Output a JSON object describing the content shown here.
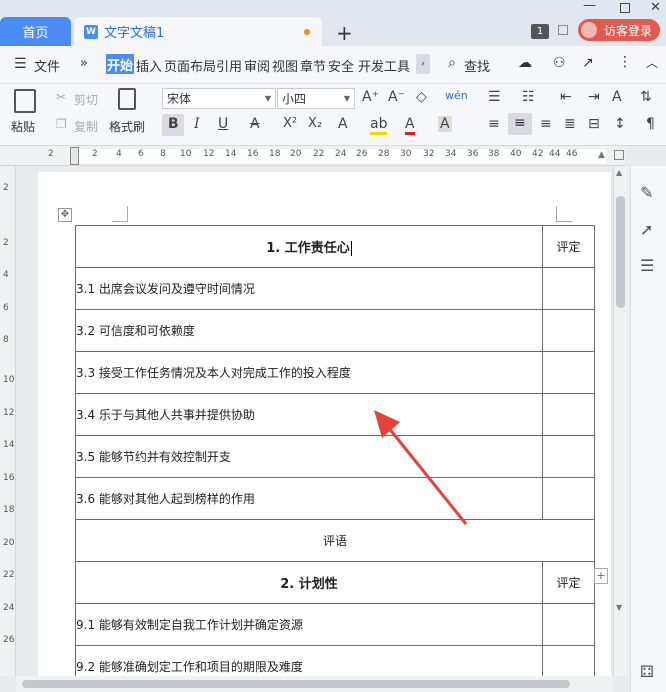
{
  "tabs": {
    "home": "首页",
    "doc_title": "文字文稿1",
    "doc_icon": "W",
    "new_tab": "+",
    "count_badge": "1",
    "login": "访客登录"
  },
  "menu": {
    "file": "文件",
    "more": "»",
    "items": [
      "开始",
      "插入",
      "页面布局",
      "引用",
      "审阅",
      "视图",
      "章节",
      "安全",
      "开发工具"
    ],
    "search": "查找"
  },
  "ribbon": {
    "paste": "粘贴",
    "cut": "剪切",
    "copy": "复制",
    "format_painter": "格式刷",
    "font_name": "宋体",
    "font_size": "小四",
    "bold": "B",
    "italic": "I",
    "underline": "U",
    "superscript": "X²",
    "subscript": "X₂"
  },
  "ruler": {
    "h": [
      "2",
      "2",
      "4",
      "6",
      "8",
      "10",
      "12",
      "14",
      "16",
      "18",
      "20",
      "22",
      "24",
      "26",
      "28",
      "30",
      "32",
      "34",
      "36",
      "38",
      "40",
      "42",
      "44",
      "46"
    ],
    "v": [
      "2",
      "2",
      "4",
      "6",
      "8",
      "10",
      "12",
      "14",
      "16",
      "18",
      "20",
      "22",
      "24",
      "26"
    ]
  },
  "table": {
    "section1_title": "1. 工作责任心",
    "rating": "评定",
    "section1_rows": [
      "3.1 出席会议发问及遵守时间情况",
      "3.2 可信度和可依赖度",
      "3.3 接受工作任务情况及本人对完成工作的投入程度",
      "3.4 乐于与其他人共事并提供协助",
      "3.5 能够节约并有效控制开支",
      "3.6 能够对其他人起到榜样的作用"
    ],
    "comments": "评语",
    "section2_title": "2. 计划性",
    "section2_rows": [
      "9.1 能够有效制定自我工作计划并确定资源",
      "9.2 能够准确划定工作和项目的期限及难度"
    ]
  },
  "colors": {
    "accent": "#4a8bf6",
    "login_bg": "#e05a4f",
    "arrow": "#e8413a",
    "modified_dot": "#f08b2b"
  }
}
